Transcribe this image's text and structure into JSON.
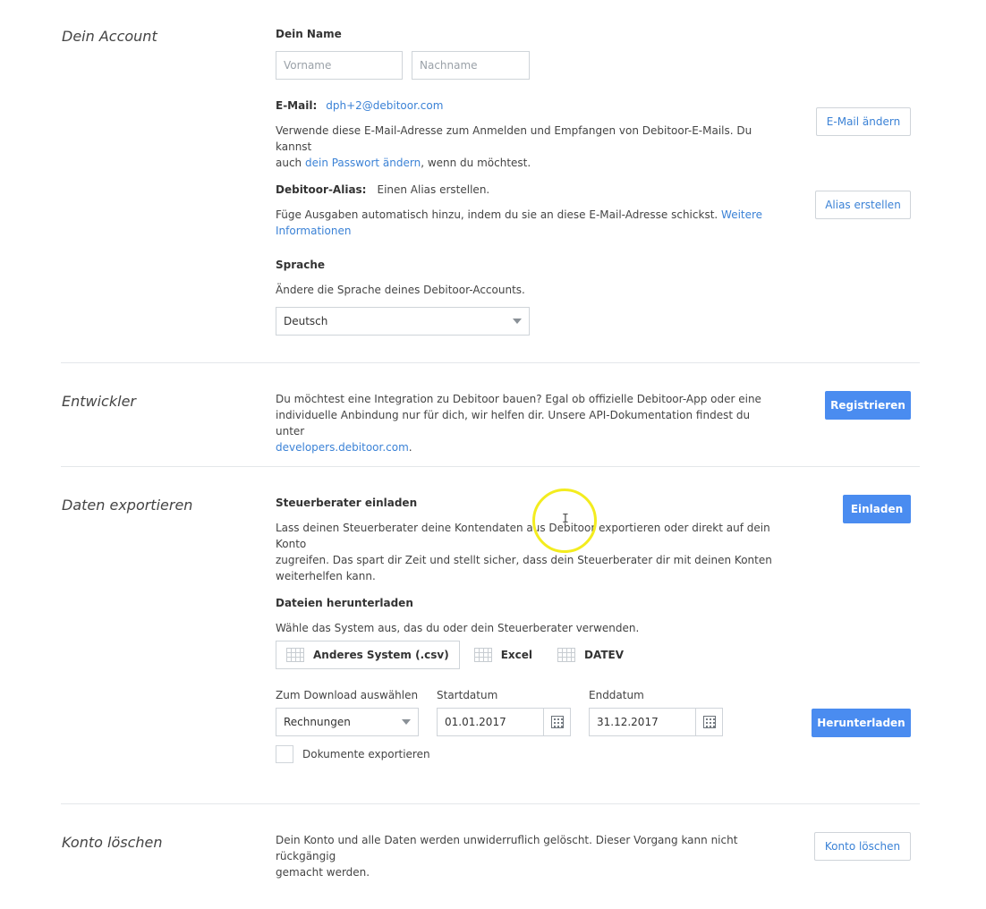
{
  "account": {
    "section_title": "Dein Account",
    "name_label": "Dein Name",
    "firstname_placeholder": "Vorname",
    "lastname_placeholder": "Nachname",
    "email_label": "E-Mail:",
    "email_value": "dph+2@debitoor.com",
    "email_desc_1": "Verwende diese E-Mail-Adresse zum Anmelden und Empfangen von Debitoor-E-Mails. Du kannst",
    "email_desc_2_prefix": "auch ",
    "email_desc_2_link": "dein Passwort ändern",
    "email_desc_2_suffix": ", wenn du möchtest.",
    "change_email_button": "E-Mail ändern",
    "alias_label": "Debitoor-Alias:",
    "alias_value": "Einen Alias erstellen.",
    "alias_desc": "Füge Ausgaben automatisch hinzu, indem du sie an diese E-Mail-Adresse schickst.",
    "alias_link_1": "Weitere",
    "alias_link_2": "Informationen",
    "create_alias_button": "Alias erstellen",
    "language_label": "Sprache",
    "language_desc": "Ändere die Sprache deines Debitoor-Accounts.",
    "language_selected": "Deutsch"
  },
  "developer": {
    "section_title": "Entwickler",
    "desc_1": "Du möchtest eine Integration zu Debitoor bauen? Egal ob offizielle Debitoor-App oder eine",
    "desc_2": "individuelle Anbindung nur für dich, wir helfen dir. Unsere API-Dokumentation findest du unter",
    "link": "developers.debitoor.com",
    "link_suffix": ".",
    "register_button": "Registrieren"
  },
  "export": {
    "section_title": "Daten exportieren",
    "invite_label": "Steuerberater einladen",
    "invite_desc_1": "Lass deinen Steuerberater deine Kontendaten aus Debitoor exportieren oder direkt auf dein Konto",
    "invite_desc_2": "zugreifen. Das spart dir Zeit und stellt sicher, dass dein Steuerberater dir mit deinen Konten",
    "invite_desc_3": "weiterhelfen kann.",
    "invite_button": "Einladen",
    "download_label": "Dateien herunterladen",
    "download_desc": "Wähle das System aus, das du oder dein Steuerberater verwenden.",
    "systems": [
      "Anderes System (.csv)",
      "Excel",
      "DATEV"
    ],
    "select_label": "Zum Download auswählen",
    "select_value": "Rechnungen",
    "start_label": "Startdatum",
    "start_value": "01.01.2017",
    "end_label": "Enddatum",
    "end_value": "31.12.2017",
    "download_button": "Herunterladen",
    "documents_label": "Dokumente exportieren"
  },
  "delete": {
    "section_title": "Konto löschen",
    "desc_1": "Dein Konto und alle Daten werden unwiderruflich gelöscht. Dieser Vorgang kann nicht rückgängig",
    "desc_2": "gemacht werden.",
    "delete_button": "Konto löschen"
  },
  "colors": {
    "accent": "#4a8cf0",
    "link": "#3b82d6",
    "cursor_highlight": "#f3ec1f"
  }
}
